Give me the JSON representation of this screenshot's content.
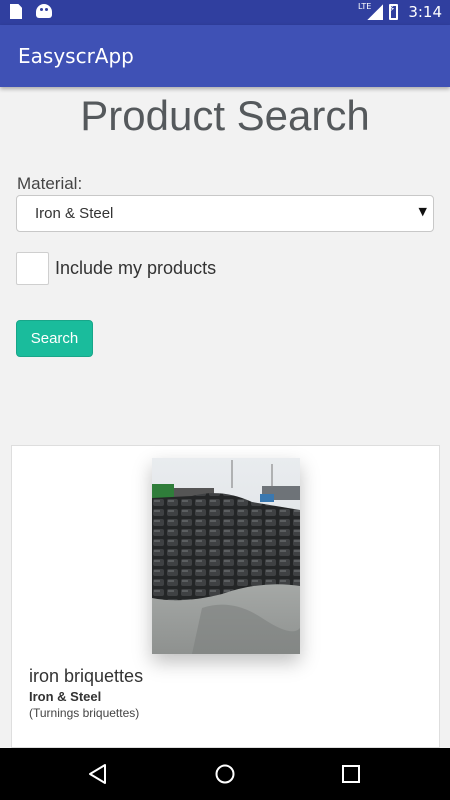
{
  "status_bar": {
    "time": "3:14",
    "network": "LTE"
  },
  "app_bar": {
    "title": "EasyscrApp"
  },
  "page": {
    "title": "Product Search"
  },
  "form": {
    "material_label": "Material:",
    "material_selected": "Iron & Steel",
    "include_my_products_label": "Include my products",
    "include_my_products_checked": false,
    "search_button": "Search"
  },
  "results": [
    {
      "name": "iron briquettes",
      "category": "Iron & Steel",
      "subtitle": "(Turnings briquettes)"
    }
  ],
  "colors": {
    "status_bar": "#303f9f",
    "app_bar": "#3f51b5",
    "search_button": "#1abc9c"
  }
}
